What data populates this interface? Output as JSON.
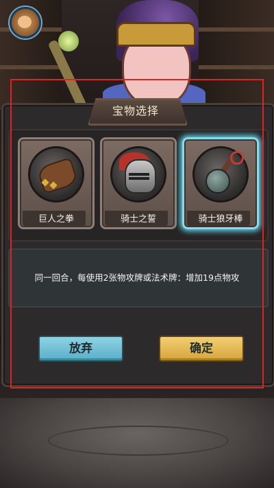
{
  "dialog": {
    "title": "宝物选择",
    "description": "同一回合，每使用2张物攻牌或法术牌：增加19点物攻"
  },
  "treasures": [
    {
      "label": "巨人之拳",
      "icon": "gauntlet-icon",
      "selected": false
    },
    {
      "label": "骑士之誓",
      "icon": "knight-helmet-icon",
      "selected": false
    },
    {
      "label": "骑士狼牙棒",
      "icon": "spiked-mace-icon",
      "selected": true
    }
  ],
  "buttons": {
    "cancel_label": "放弃",
    "confirm_label": "确定"
  },
  "colors": {
    "selection_glow": "#5fd0e8",
    "cancel_button": "#8fd3e3",
    "confirm_button": "#e8bd58",
    "highlight_frame": "#e52020"
  }
}
